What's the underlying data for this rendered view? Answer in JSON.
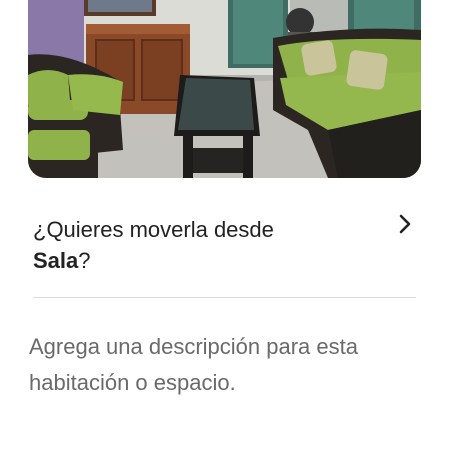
{
  "photo": {
    "icon": "living-room-photo"
  },
  "move_prompt": {
    "question": "¿Quieres moverla desde",
    "room": "Sala",
    "question_end": "?",
    "icon": "chevron-right-icon"
  },
  "description": {
    "placeholder": "Agrega una descripción para esta habitación o espacio."
  },
  "colors": {
    "text_primary": "#222222",
    "text_secondary": "#6a6a6a",
    "divider": "#dddddd",
    "cushion_green": "#8fb24a"
  }
}
